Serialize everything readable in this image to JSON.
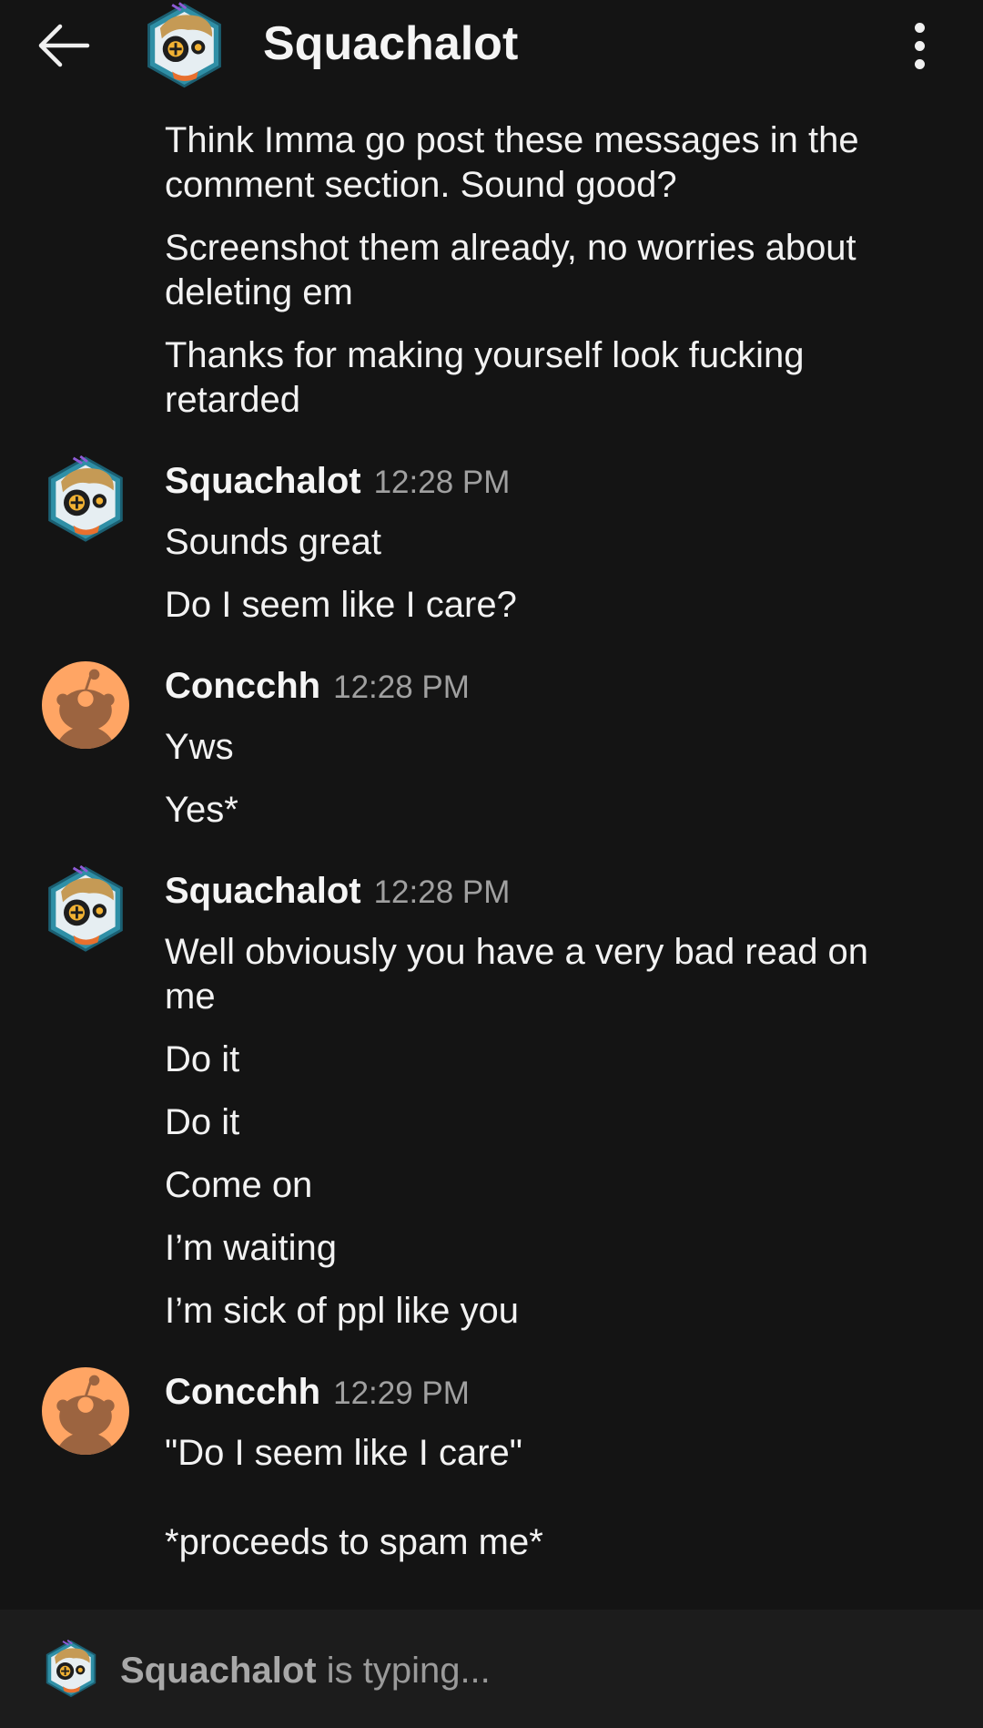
{
  "header": {
    "title": "Squachalot"
  },
  "colors": {
    "background": "#141414",
    "typing_bar": "#1c1c1c",
    "snoo_orange": "#FFA564",
    "snoo_body": "#9C6440"
  },
  "messages": {
    "pre": [
      "Think Imma go post these messages in the comment section. Sound good?",
      "Screenshot them already, no worries about deleting em",
      "Thanks for making yourself look fucking retarded"
    ],
    "group1": {
      "author": "Squachalot",
      "time": "12:28 PM",
      "lines": [
        "Sounds great",
        "Do I seem like I care?"
      ]
    },
    "group2": {
      "author": "Concchh",
      "time": "12:28 PM",
      "lines": [
        "Yws",
        "Yes*"
      ]
    },
    "group3": {
      "author": "Squachalot",
      "time": "12:28 PM",
      "lines": [
        "Well obviously you have a very bad read on me",
        "Do it",
        "Do it",
        "Come on",
        "I’m waiting",
        "I’m sick of ppl like you"
      ]
    },
    "group4": {
      "author": "Concchh",
      "time": "12:29 PM",
      "line1": "\"Do I seem like I care\"",
      "line2": "*proceeds to spam me*"
    }
  },
  "typing": {
    "user": "Squachalot",
    "suffix": " is typing..."
  }
}
